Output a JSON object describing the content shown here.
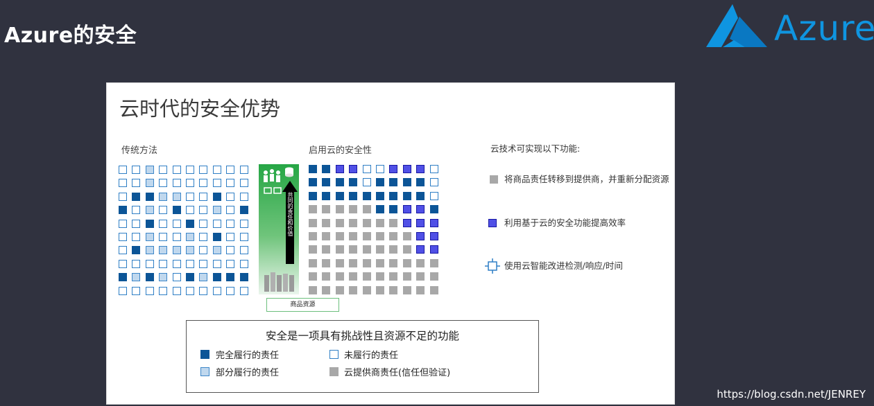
{
  "header": {
    "title": "Azure的安全",
    "logo_text": "Azure"
  },
  "slide": {
    "title": "云时代的安全优势",
    "traditional_label": "传统方法",
    "cloud_label": "启用云的安全性",
    "green_panel": {
      "arrow_text": "共同的责任和价值",
      "goods_label": "商品资源"
    },
    "features": {
      "heading": "云技术可实现以下功能:",
      "items": [
        {
          "text": "将商品责任转移到提供商，并重新分配资源",
          "icon": "gray-square-icon"
        },
        {
          "text": "利用基于云的安全功能提高效率",
          "icon": "blue-square-icon"
        },
        {
          "text": "使用云智能改进检测/响应/时间",
          "icon": "crosshair-square-icon"
        }
      ]
    },
    "legend": {
      "title": "安全是一项具有挑战性且资源不足的功能",
      "items": [
        {
          "label": "完全履行的责任",
          "swatch": "#0c5597"
        },
        {
          "label": "未履行的责任",
          "swatch": "#ffffff"
        },
        {
          "label": "部分履行的责任",
          "swatch": "#c0d8ee"
        },
        {
          "label": "云提供商责任(信任但验证)",
          "swatch": "#a8a8a8"
        }
      ]
    },
    "left_grid": [
      [
        0,
        0,
        1,
        0,
        0,
        0,
        0,
        0,
        0,
        0
      ],
      [
        0,
        0,
        1,
        0,
        0,
        0,
        0,
        0,
        0,
        0
      ],
      [
        0,
        2,
        2,
        1,
        1,
        0,
        0,
        2,
        0,
        0
      ],
      [
        2,
        0,
        1,
        0,
        2,
        0,
        0,
        1,
        0,
        2
      ],
      [
        0,
        0,
        2,
        0,
        0,
        2,
        0,
        0,
        0,
        0
      ],
      [
        0,
        0,
        1,
        0,
        0,
        1,
        0,
        2,
        0,
        0
      ],
      [
        0,
        2,
        1,
        1,
        1,
        1,
        0,
        1,
        0,
        0
      ],
      [
        0,
        0,
        0,
        0,
        0,
        0,
        0,
        0,
        0,
        0
      ],
      [
        2,
        1,
        2,
        1,
        0,
        2,
        1,
        2,
        2,
        2
      ],
      [
        0,
        0,
        0,
        0,
        0,
        0,
        0,
        0,
        0,
        0
      ]
    ],
    "right_grid": [
      [
        2,
        2,
        4,
        4,
        0,
        0,
        4,
        4,
        4,
        0
      ],
      [
        2,
        2,
        2,
        2,
        0,
        2,
        2,
        2,
        2,
        0
      ],
      [
        2,
        2,
        2,
        2,
        2,
        2,
        2,
        2,
        2,
        0
      ],
      [
        3,
        3,
        3,
        3,
        3,
        2,
        2,
        4,
        4,
        2
      ],
      [
        3,
        3,
        3,
        3,
        3,
        3,
        3,
        4,
        4,
        4
      ],
      [
        3,
        3,
        3,
        3,
        3,
        3,
        3,
        3,
        4,
        4
      ],
      [
        3,
        3,
        3,
        3,
        3,
        3,
        3,
        3,
        4,
        4
      ],
      [
        3,
        3,
        3,
        3,
        3,
        3,
        3,
        3,
        3,
        3
      ],
      [
        3,
        3,
        3,
        3,
        3,
        3,
        3,
        3,
        3,
        3
      ],
      [
        3,
        3,
        3,
        3,
        3,
        3,
        3,
        3,
        3,
        3
      ]
    ]
  },
  "watermark": "https://blog.csdn.net/JENREY"
}
